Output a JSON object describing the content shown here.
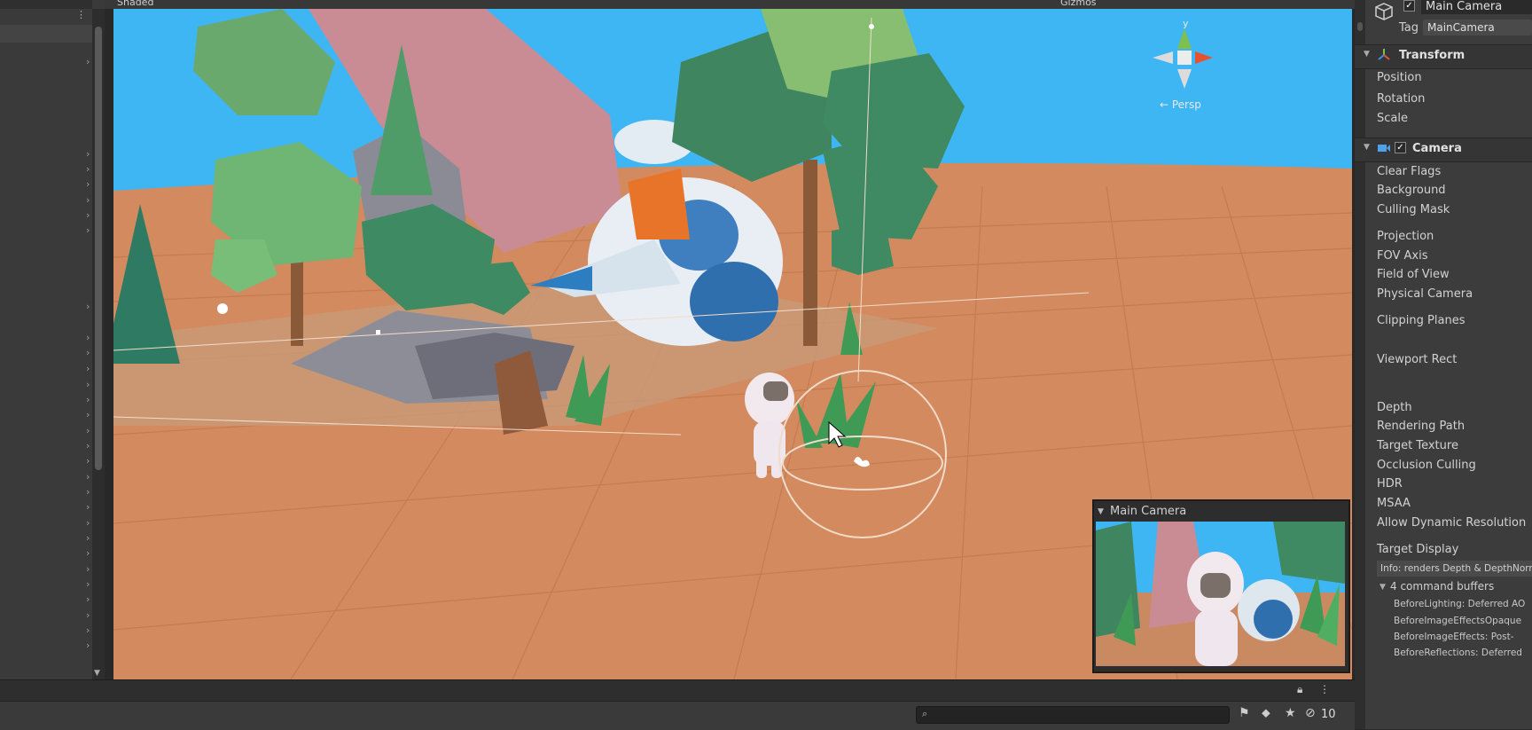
{
  "scene_toolbar": {
    "shading_mode": "Shaded",
    "gizmos_label": "Gizmos"
  },
  "scene_view": {
    "projection_label": "← Persp",
    "axis_y_label": "y"
  },
  "camera_preview": {
    "title": "Main Camera"
  },
  "inspector": {
    "object_name": "Main Camera",
    "tag_label": "Tag",
    "tag_value": "MainCamera",
    "transform": {
      "title": "Transform",
      "fields": [
        "Position",
        "Rotation",
        "Scale"
      ]
    },
    "camera": {
      "title": "Camera",
      "fields": [
        "Clear Flags",
        "Background",
        "Culling Mask",
        "Projection",
        "FOV Axis",
        "Field of View",
        "Physical Camera",
        "Clipping Planes",
        "Viewport Rect",
        "Depth",
        "Rendering Path",
        "Target Texture",
        "Occlusion Culling",
        "HDR",
        "MSAA",
        "Allow Dynamic Resolution",
        "Target Display"
      ],
      "info_text": "Info: renders Depth & DepthNormals",
      "command_buffers_label": "4 command buffers",
      "command_buffers": [
        "BeforeLighting: Deferred AO",
        "BeforeImageEffectsOpaque",
        "BeforeImageEffects: Post-",
        "BeforeReflections: Deferred"
      ]
    }
  },
  "status_bar": {
    "hidden_count": "10"
  },
  "colors": {
    "sky": "#3fb6f4",
    "ground": "#d38a5e",
    "editor_panel": "#3c3c3c",
    "accent_orange": "#e8742a"
  }
}
